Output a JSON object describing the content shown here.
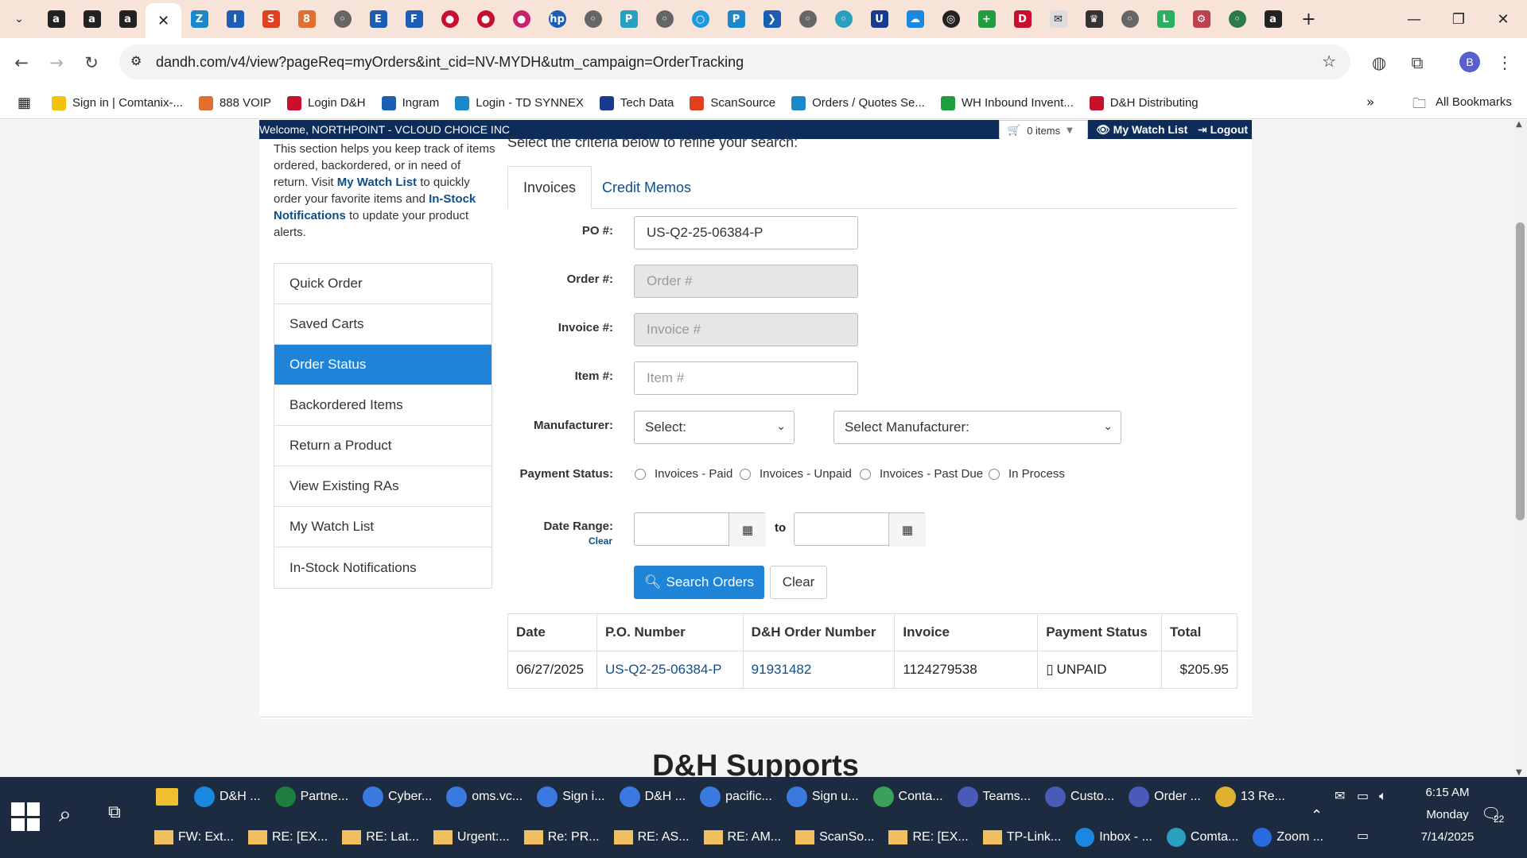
{
  "browser": {
    "url": "dandh.com/v4/view?pageReq=myOrders&int_cid=NV-MYDH&utm_campaign=OrderTracking",
    "profile_initial": "B",
    "bookmarks": [
      {
        "label": "Sign in | Comtanix-...",
        "color": "#f4c20d"
      },
      {
        "label": "888 VOIP",
        "color": "#e07030"
      },
      {
        "label": "Login D&H",
        "color": "#c8102e"
      },
      {
        "label": "Ingram",
        "color": "#1a5fb4"
      },
      {
        "label": "Login - TD SYNNEX",
        "color": "#1a88c9"
      },
      {
        "label": "Tech Data",
        "color": "#1a3a8f"
      },
      {
        "label": "ScanSource",
        "color": "#e04020"
      },
      {
        "label": "Orders / Quotes Se...",
        "color": "#1a88c9"
      },
      {
        "label": "WH Inbound Invent...",
        "color": "#1e9e3e"
      },
      {
        "label": "D&H Distributing",
        "color": "#c8102e"
      }
    ],
    "all_bookmarks_label": "All Bookmarks"
  },
  "topbar": {
    "welcome": "Welcome, NORTHPOINT - VCLOUD CHOICE INC",
    "cart": "0 items",
    "watch_list": "My Watch List",
    "logout": "Logout"
  },
  "intro": {
    "part1": "This section helps you keep track of items ordered, backordered, or in need of return. Visit ",
    "link1": "My Watch List",
    "part2": " to quickly order your favorite items and ",
    "link2": "In-Stock Notifications",
    "part3": " to update your product alerts."
  },
  "sidenav": [
    {
      "label": "Quick Order",
      "active": false
    },
    {
      "label": "Saved Carts",
      "active": false
    },
    {
      "label": "Order Status",
      "active": true
    },
    {
      "label": "Backordered Items",
      "active": false
    },
    {
      "label": "Return a Product",
      "active": false
    },
    {
      "label": "View Existing RAs",
      "active": false
    },
    {
      "label": "My Watch List",
      "active": false
    },
    {
      "label": "In-Stock Notifications",
      "active": false
    }
  ],
  "search": {
    "criteria_text": "Select the criteria below to refine your search:",
    "tabs": [
      "Invoices",
      "Credit Memos"
    ],
    "po_label": "PO #:",
    "po_value": "US-Q2-25-06384-P",
    "order_label": "Order #:",
    "order_placeholder": "Order #",
    "invoice_label": "Invoice #:",
    "invoice_placeholder": "Invoice #",
    "item_label": "Item #:",
    "item_placeholder": "Item #",
    "manufacturer_label": "Manufacturer:",
    "manufacturer_select1": "Select:",
    "manufacturer_select2": "Select Manufacturer:",
    "payment_label": "Payment Status:",
    "payment_options": [
      "Invoices - Paid",
      "Invoices - Unpaid",
      "Invoices - Past Due",
      "In Process"
    ],
    "date_label": "Date Range:",
    "date_clear": "Clear",
    "date_to": "to",
    "search_button": "Search Orders",
    "clear_button": "Clear"
  },
  "results": {
    "headers": [
      "Date",
      "P.O. Number",
      "D&H Order Number",
      "Invoice",
      "Payment Status",
      "Total"
    ],
    "rows": [
      [
        "06/27/2025",
        "US-Q2-25-06384-P",
        "91931482",
        "1124279538",
        "UNPAID",
        "$205.95"
      ]
    ]
  },
  "footer_heading": "D&H Supports",
  "taskbar": {
    "row1": [
      "D&H ...",
      "Partne...",
      "Cyber...",
      "oms.vc...",
      "Sign i...",
      "D&H ...",
      "pacific...",
      "Sign u...",
      "Conta...",
      "Teams...",
      "Custo...",
      "Order ...",
      "13 Re..."
    ],
    "row2": [
      "FW: Ext...",
      "RE: [EX...",
      "RE: Lat...",
      "Urgent:...",
      "Re: PR...",
      "RE: AS...",
      "RE: AM...",
      "ScanSo...",
      "RE: [EX...",
      "TP-Link...",
      "Inbox - ...",
      "Comta...",
      "Zoom ..."
    ],
    "time": "6:15 AM",
    "day": "Monday",
    "date": "7/14/2025",
    "notifications": "22"
  }
}
